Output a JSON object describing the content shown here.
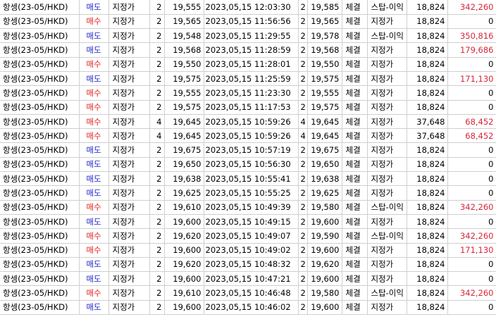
{
  "colors": {
    "sell": "#1f24c8",
    "buy": "#e0201f",
    "profit": "#d6263a"
  },
  "rows": [
    {
      "sym": "항셍(23-05/HKD)",
      "side": "매도",
      "sideType": "sell",
      "otype": "지정가",
      "qty": "2",
      "price": "19,555",
      "time": "2023,05,15 12:03:30",
      "fqty": "2",
      "fprice": "19,585",
      "status": "체결",
      "ctype": "스탑-이익",
      "amount": "18,824",
      "pnl": "342,260"
    },
    {
      "sym": "항셍(23-05/HKD)",
      "side": "매수",
      "sideType": "buy",
      "otype": "지정가",
      "qty": "2",
      "price": "19,565",
      "time": "2023,05,15 11:56:56",
      "fqty": "2",
      "fprice": "19,565",
      "status": "체결",
      "ctype": "지정가",
      "amount": "18,824",
      "pnl": "0"
    },
    {
      "sym": "항셍(23-05/HKD)",
      "side": "매도",
      "sideType": "sell",
      "otype": "지정가",
      "qty": "2",
      "price": "19,548",
      "time": "2023,05,15 11:29:55",
      "fqty": "2",
      "fprice": "19,578",
      "status": "체결",
      "ctype": "스탑-이익",
      "amount": "18,824",
      "pnl": "350,816"
    },
    {
      "sym": "항셍(23-05/HKD)",
      "side": "매도",
      "sideType": "sell",
      "otype": "지정가",
      "qty": "2",
      "price": "19,568",
      "time": "2023,05,15 11:28:59",
      "fqty": "2",
      "fprice": "19,568",
      "status": "체결",
      "ctype": "지정가",
      "amount": "18,824",
      "pnl": "179,686"
    },
    {
      "sym": "항셍(23-05/HKD)",
      "side": "매수",
      "sideType": "buy",
      "otype": "지정가",
      "qty": "2",
      "price": "19,550",
      "time": "2023,05,15 11:28:01",
      "fqty": "2",
      "fprice": "19,550",
      "status": "체결",
      "ctype": "지정가",
      "amount": "18,824",
      "pnl": "0"
    },
    {
      "sym": "항셍(23-05/HKD)",
      "side": "매도",
      "sideType": "sell",
      "otype": "지정가",
      "qty": "2",
      "price": "19,575",
      "time": "2023,05,15 11:25:59",
      "fqty": "2",
      "fprice": "19,575",
      "status": "체결",
      "ctype": "지정가",
      "amount": "18,824",
      "pnl": "171,130"
    },
    {
      "sym": "항셍(23-05/HKD)",
      "side": "매수",
      "sideType": "buy",
      "otype": "지정가",
      "qty": "2",
      "price": "19,555",
      "time": "2023,05,15 11:23:30",
      "fqty": "2",
      "fprice": "19,555",
      "status": "체결",
      "ctype": "지정가",
      "amount": "18,824",
      "pnl": "0"
    },
    {
      "sym": "항셍(23-05/HKD)",
      "side": "매수",
      "sideType": "buy",
      "otype": "지정가",
      "qty": "2",
      "price": "19,575",
      "time": "2023,05,15 11:17:53",
      "fqty": "2",
      "fprice": "19,575",
      "status": "체결",
      "ctype": "지정가",
      "amount": "18,824",
      "pnl": "0"
    },
    {
      "sym": "항셍(23-05/HKD)",
      "side": "매수",
      "sideType": "buy",
      "otype": "지정가",
      "qty": "4",
      "price": "19,645",
      "time": "2023,05,15 10:59:26",
      "fqty": "4",
      "fprice": "19,645",
      "status": "체결",
      "ctype": "지정가",
      "amount": "37,648",
      "pnl": "68,452"
    },
    {
      "sym": "항셍(23-05/HKD)",
      "side": "매수",
      "sideType": "buy",
      "otype": "지정가",
      "qty": "4",
      "price": "19,645",
      "time": "2023,05,15 10:59:26",
      "fqty": "4",
      "fprice": "19,645",
      "status": "체결",
      "ctype": "지정가",
      "amount": "37,648",
      "pnl": "68,452"
    },
    {
      "sym": "항셍(23-05/HKD)",
      "side": "매도",
      "sideType": "sell",
      "otype": "지정가",
      "qty": "2",
      "price": "19,675",
      "time": "2023,05,15 10:57:19",
      "fqty": "2",
      "fprice": "19,675",
      "status": "체결",
      "ctype": "지정가",
      "amount": "18,824",
      "pnl": "0"
    },
    {
      "sym": "항셍(23-05/HKD)",
      "side": "매도",
      "sideType": "sell",
      "otype": "지정가",
      "qty": "2",
      "price": "19,650",
      "time": "2023,05,15 10:56:30",
      "fqty": "2",
      "fprice": "19,650",
      "status": "체결",
      "ctype": "지정가",
      "amount": "18,824",
      "pnl": "0"
    },
    {
      "sym": "항셍(23-05/HKD)",
      "side": "매도",
      "sideType": "sell",
      "otype": "지정가",
      "qty": "2",
      "price": "19,638",
      "time": "2023,05,15 10:55:41",
      "fqty": "2",
      "fprice": "19,638",
      "status": "체결",
      "ctype": "지정가",
      "amount": "18,824",
      "pnl": "0"
    },
    {
      "sym": "항셍(23-05/HKD)",
      "side": "매도",
      "sideType": "sell",
      "otype": "지정가",
      "qty": "2",
      "price": "19,625",
      "time": "2023,05,15 10:55:25",
      "fqty": "2",
      "fprice": "19,625",
      "status": "체결",
      "ctype": "지정가",
      "amount": "18,824",
      "pnl": "0"
    },
    {
      "sym": "항셍(23-05/HKD)",
      "side": "매수",
      "sideType": "buy",
      "otype": "지정가",
      "qty": "2",
      "price": "19,610",
      "time": "2023,05,15 10:49:39",
      "fqty": "2",
      "fprice": "19,580",
      "status": "체결",
      "ctype": "스탑-이익",
      "amount": "18,824",
      "pnl": "342,260"
    },
    {
      "sym": "항셍(23-05/HKD)",
      "side": "매도",
      "sideType": "sell",
      "otype": "지정가",
      "qty": "2",
      "price": "19,600",
      "time": "2023,05,15 10:49:15",
      "fqty": "2",
      "fprice": "19,600",
      "status": "체결",
      "ctype": "지정가",
      "amount": "18,824",
      "pnl": "0"
    },
    {
      "sym": "항셍(23-05/HKD)",
      "side": "매수",
      "sideType": "buy",
      "otype": "지정가",
      "qty": "2",
      "price": "19,620",
      "time": "2023,05,15 10:49:07",
      "fqty": "2",
      "fprice": "19,590",
      "status": "체결",
      "ctype": "스탑-이익",
      "amount": "18,824",
      "pnl": "342,260"
    },
    {
      "sym": "항셍(23-05/HKD)",
      "side": "매수",
      "sideType": "buy",
      "otype": "지정가",
      "qty": "2",
      "price": "19,600",
      "time": "2023,05,15 10:49:02",
      "fqty": "2",
      "fprice": "19,600",
      "status": "체결",
      "ctype": "지정가",
      "amount": "18,824",
      "pnl": "171,130"
    },
    {
      "sym": "항셍(23-05/HKD)",
      "side": "매도",
      "sideType": "sell",
      "otype": "지정가",
      "qty": "2",
      "price": "19,620",
      "time": "2023,05,15 10:48:32",
      "fqty": "2",
      "fprice": "19,620",
      "status": "체결",
      "ctype": "지정가",
      "amount": "18,824",
      "pnl": "0"
    },
    {
      "sym": "항셍(23-05/HKD)",
      "side": "매도",
      "sideType": "sell",
      "otype": "지정가",
      "qty": "2",
      "price": "19,600",
      "time": "2023,05,15 10:47:21",
      "fqty": "2",
      "fprice": "19,600",
      "status": "체결",
      "ctype": "지정가",
      "amount": "18,824",
      "pnl": "0"
    },
    {
      "sym": "항셍(23-05/HKD)",
      "side": "매수",
      "sideType": "buy",
      "otype": "지정가",
      "qty": "2",
      "price": "19,610",
      "time": "2023,05,15 10:46:48",
      "fqty": "2",
      "fprice": "19,580",
      "status": "체결",
      "ctype": "스탑-이익",
      "amount": "18,824",
      "pnl": "342,260"
    },
    {
      "sym": "항셍(23-05/HKD)",
      "side": "매도",
      "sideType": "sell",
      "otype": "지정가",
      "qty": "2",
      "price": "19,600",
      "time": "2023,05,15 10:46:02",
      "fqty": "2",
      "fprice": "19,600",
      "status": "체결",
      "ctype": "지정가",
      "amount": "18,824",
      "pnl": "0"
    }
  ]
}
